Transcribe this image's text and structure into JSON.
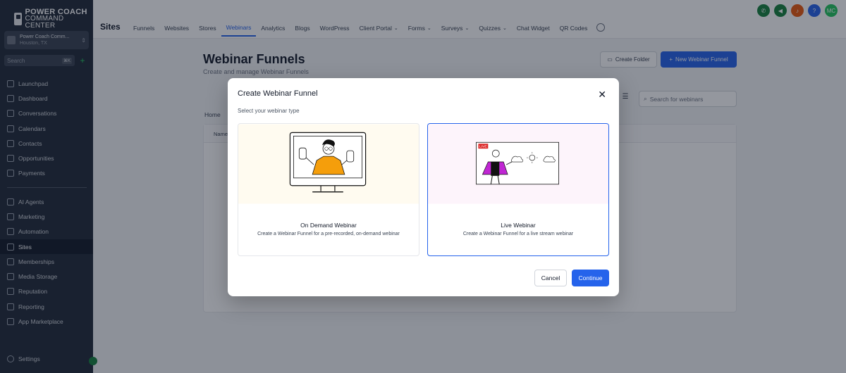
{
  "app": {
    "logo_line1": "POWER COACH",
    "logo_line2": "COMMAND CENTER"
  },
  "account": {
    "name": "Power Coach Comm...",
    "location": "Houston, TX"
  },
  "sidebar": {
    "search_placeholder": "Search",
    "search_shortcut": "⌘K",
    "items": [
      {
        "label": "Launchpad",
        "icon": "rocket-icon"
      },
      {
        "label": "Dashboard",
        "icon": "dashboard-icon"
      },
      {
        "label": "Conversations",
        "icon": "chat-icon"
      },
      {
        "label": "Calendars",
        "icon": "calendar-icon"
      },
      {
        "label": "Contacts",
        "icon": "contacts-icon"
      },
      {
        "label": "Opportunities",
        "icon": "opportunities-icon"
      },
      {
        "label": "Payments",
        "icon": "payments-icon"
      }
    ],
    "items2": [
      {
        "label": "AI Agents",
        "icon": "sparkle-icon"
      },
      {
        "label": "Marketing",
        "icon": "send-icon"
      },
      {
        "label": "Automation",
        "icon": "automation-icon"
      },
      {
        "label": "Sites",
        "icon": "sites-icon",
        "active": true
      },
      {
        "label": "Memberships",
        "icon": "memberships-icon"
      },
      {
        "label": "Media Storage",
        "icon": "media-icon"
      },
      {
        "label": "Reputation",
        "icon": "star-icon"
      },
      {
        "label": "Reporting",
        "icon": "chart-icon"
      },
      {
        "label": "App Marketplace",
        "icon": "grid-icon"
      }
    ],
    "settings_label": "Settings"
  },
  "topbar": {
    "section_title": "Sites",
    "tabs": [
      {
        "label": "Funnels"
      },
      {
        "label": "Websites"
      },
      {
        "label": "Stores"
      },
      {
        "label": "Webinars",
        "active": true
      },
      {
        "label": "Analytics"
      },
      {
        "label": "Blogs"
      },
      {
        "label": "WordPress"
      },
      {
        "label": "Client Portal",
        "caret": true
      },
      {
        "label": "Forms",
        "caret": true
      },
      {
        "label": "Surveys",
        "caret": true
      },
      {
        "label": "Quizzes",
        "caret": true
      },
      {
        "label": "Chat Widget"
      },
      {
        "label": "QR Codes"
      }
    ],
    "avatar_initials": "MC",
    "icon_colors": [
      "#15803d",
      "#15803d",
      "#ea580c",
      "#2563eb",
      "#22c55e"
    ]
  },
  "page": {
    "title": "Webinar Funnels",
    "subtitle": "Create and manage Webinar Funnels",
    "create_folder_label": "Create Folder",
    "new_funnel_label": "New Webinar Funnel",
    "search_placeholder": "Search for webinars",
    "breadcrumb": "Home",
    "table_header_name": "Name"
  },
  "modal": {
    "title": "Create Webinar Funnel",
    "subtitle": "Select your webinar type",
    "cards": [
      {
        "title": "On Demand Webinar",
        "description": "Create a Webinar Funnel for a pre-recorded, on-demand webinar",
        "selected": false
      },
      {
        "title": "Live Webinar",
        "description": "Create a Webinar Funnel for a live stream webinar",
        "selected": true,
        "live_badge": "LIVE"
      }
    ],
    "cancel_label": "Cancel",
    "continue_label": "Continue"
  }
}
